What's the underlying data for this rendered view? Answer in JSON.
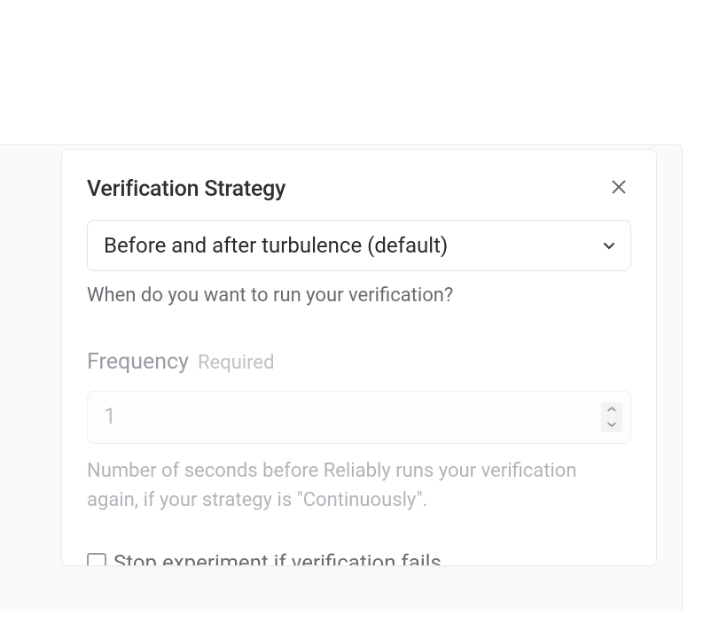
{
  "modal": {
    "title": "Verification Strategy",
    "strategy_select": {
      "value": "Before and after turbulence (default)"
    },
    "strategy_help": "When do you want to run your verification?",
    "frequency": {
      "label": "Frequency",
      "required_label": "Required",
      "value": "1",
      "help": "Number of seconds before Reliably runs your verification again, if your strategy is \"Continuously\"."
    },
    "stop_checkbox": {
      "label": "Stop experiment if verification fails"
    }
  }
}
